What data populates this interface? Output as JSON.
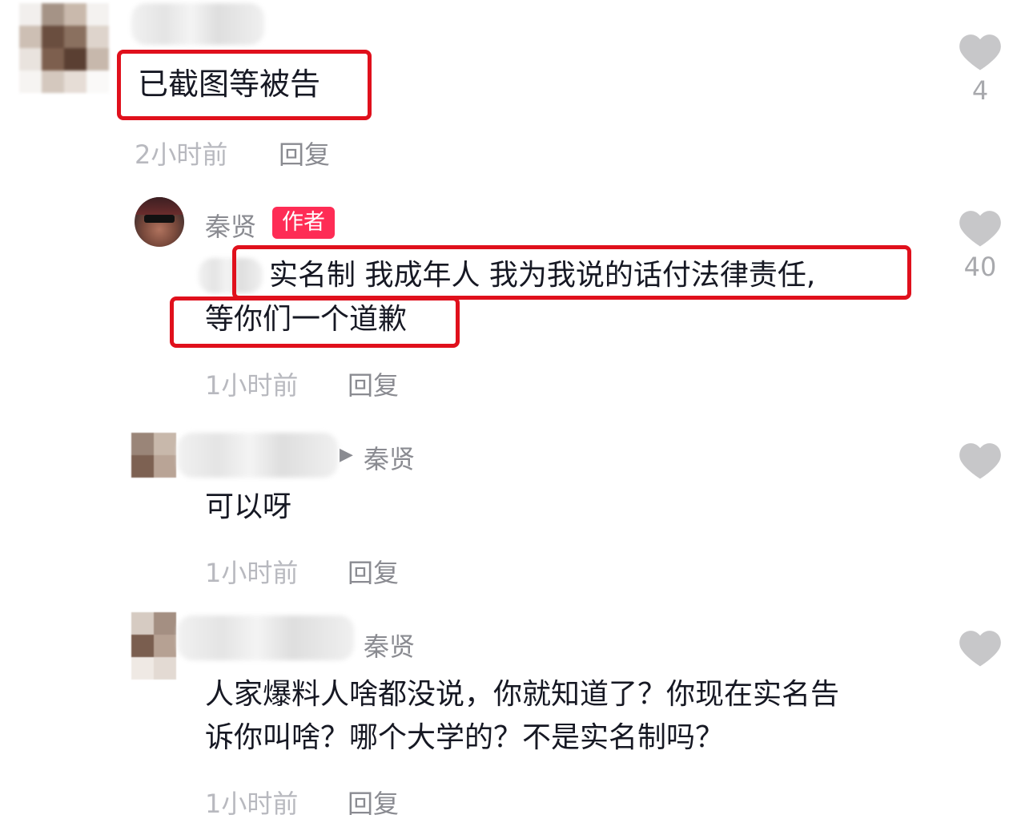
{
  "comments": [
    {
      "text": "已截图等被告",
      "time": "2小时前",
      "reply": "回复",
      "likes": "4"
    },
    {
      "author": "秦贤",
      "badge": "作者",
      "line1": "实名制 我成年人 我为我说的话付法律责任,",
      "line2": "等你们一个道歉",
      "time": "1小时前",
      "reply": "回复",
      "likes": "40"
    },
    {
      "reply_to": "秦贤",
      "text": "可以呀",
      "time": "1小时前",
      "reply": "回复",
      "likes": ""
    },
    {
      "reply_to": "秦贤",
      "line1": "人家爆料人啥都没说，你就知道了？你现在实名告",
      "line2": "诉你叫啥？哪个大学的？不是实名制吗？",
      "time": "1小时前",
      "reply": "回复",
      "likes": ""
    }
  ],
  "colors": {
    "highlight_box": "#e0101c",
    "author_badge": "#fe2c55",
    "like_icon": "#c7c7c9"
  },
  "icons": [
    "heart-icon",
    "caret-right-icon"
  ]
}
